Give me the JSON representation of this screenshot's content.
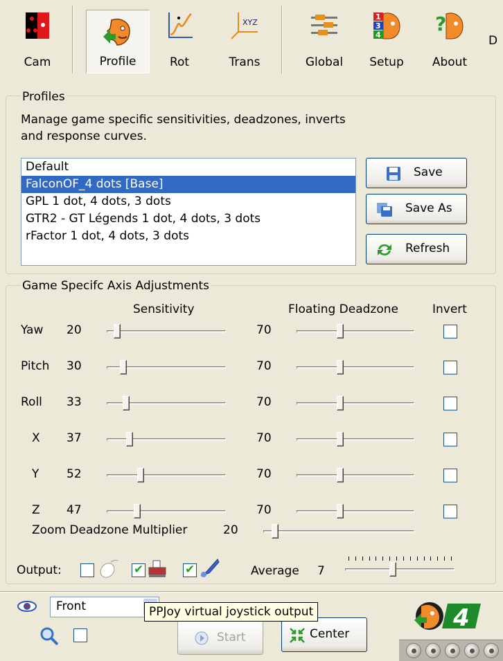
{
  "toolbar": {
    "buttons": [
      {
        "id": "cam",
        "label": "Cam",
        "icon": "cam-icon"
      },
      {
        "id": "profile",
        "label": "Profile",
        "icon": "profile-head-icon",
        "active": true
      },
      {
        "id": "rot",
        "label": "Rot",
        "icon": "curve-graph-icon"
      },
      {
        "id": "trans",
        "label": "Trans",
        "icon": "xyz-axis-icon"
      },
      {
        "id": "global",
        "label": "Global",
        "icon": "sliders-icon"
      },
      {
        "id": "setup",
        "label": "Setup",
        "icon": "setup-numbers-icon"
      },
      {
        "id": "about",
        "label": "About",
        "icon": "question-head-icon"
      }
    ],
    "overflow_text": "D"
  },
  "profiles": {
    "title": "Profiles",
    "description_line1": "Manage game specific sensitivities, deadzones, inverts",
    "description_line2": "and response curves.",
    "items": [
      "Default",
      "FalconOF_4 dots [Base]",
      "GPL 1 dot, 4 dots, 3 dots",
      "GTR2 - GT Légends 1 dot, 4 dots, 3 dots",
      "rFactor 1 dot, 4 dots, 3 dots"
    ],
    "selected_index": 1,
    "save_label": "Save",
    "save_as_label": "Save As",
    "refresh_label": "Refresh"
  },
  "axis": {
    "title": "Game Specifc Axis Adjustments",
    "col_sensitivity": "Sensitivity",
    "col_deadzone": "Floating Deadzone",
    "col_invert": "Invert",
    "rows": [
      {
        "label": "Yaw",
        "sensitivity": "20",
        "deadzone": "70",
        "sens_level": 0.06,
        "dz_level": 0.36,
        "invert": false
      },
      {
        "label": "Pitch",
        "sensitivity": "30",
        "deadzone": "70",
        "sens_level": 0.12,
        "dz_level": 0.36,
        "invert": false
      },
      {
        "label": "Roll",
        "sensitivity": "33",
        "deadzone": "70",
        "sens_level": 0.14,
        "dz_level": 0.36,
        "invert": false
      },
      {
        "label": "X",
        "sensitivity": "37",
        "deadzone": "70",
        "sens_level": 0.17,
        "dz_level": 0.36,
        "invert": false
      },
      {
        "label": "Y",
        "sensitivity": "52",
        "deadzone": "70",
        "sens_level": 0.27,
        "dz_level": 0.36,
        "invert": false
      },
      {
        "label": "Z",
        "sensitivity": "47",
        "deadzone": "70",
        "sens_level": 0.24,
        "dz_level": 0.36,
        "invert": false
      }
    ],
    "zoom_label": "Zoom Deadzone Multiplier",
    "zoom_value": "20",
    "zoom_level": 0.06,
    "output_label": "Output:",
    "average_label": "Average",
    "average_value": "7",
    "average_level": 0.43
  },
  "bottom": {
    "view_select": "Front",
    "tooltip": "PPJoy virtual joystick output",
    "start_label": "Start",
    "center_label": "Center"
  }
}
